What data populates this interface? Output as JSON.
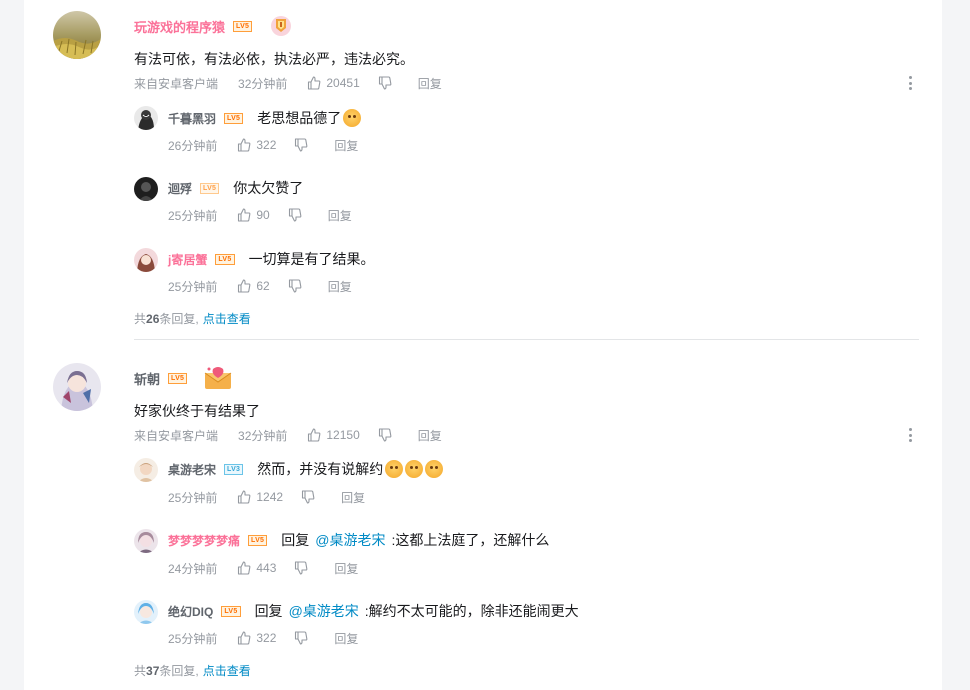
{
  "comments": [
    {
      "username": "玩游戏的程序猿",
      "level": "LV5",
      "content": "有法可依，有法必依，执法必严，违法必究。",
      "source": "来自安卓客户端",
      "time": "32分钟前",
      "likes": "20451",
      "reply_label": "回复",
      "replies": [
        {
          "username": "千暮黑羽",
          "level": "LV5",
          "text": "老思想品德了",
          "time": "26分钟前",
          "likes": "322"
        },
        {
          "username": "迴殍",
          "level": "LV5",
          "text": "你太欠赞了",
          "time": "25分钟前",
          "likes": "90"
        },
        {
          "username": "j寄居蟹",
          "level": "LV5",
          "text": "一切算是有了结果。",
          "time": "25分钟前",
          "likes": "62"
        }
      ],
      "summary": {
        "prefix": "共",
        "count": "26",
        "suffix": "条回复,",
        "link": "点击查看"
      }
    },
    {
      "username": "斩朝",
      "level": "LV5",
      "content": "好家伙终于有结果了",
      "source": "来自安卓客户端",
      "time": "32分钟前",
      "likes": "12150",
      "reply_label": "回复",
      "replies": [
        {
          "username": "桌游老宋",
          "level": "LV3",
          "text": "然而，并没有说解约",
          "time": "25分钟前",
          "likes": "1242"
        },
        {
          "username": "梦梦梦梦梦痛",
          "level": "LV5",
          "reply_word": "回复",
          "at": "@桌游老宋",
          "text": ":这都上法庭了，还解什么",
          "time": "24分钟前",
          "likes": "443"
        },
        {
          "username": "绝幻DIQ",
          "level": "LV5",
          "reply_word": "回复",
          "at": "@桌游老宋",
          "text": ":解约不太可能的，除非还能闹更大",
          "time": "25分钟前",
          "likes": "322"
        }
      ],
      "summary": {
        "prefix": "共",
        "count": "37",
        "suffix": "条回复,",
        "link": "点击查看"
      }
    }
  ],
  "colors": {
    "pink": "#fb7299",
    "link": "#008ac5",
    "meta": "#9499a0",
    "level_orange": "#ff6f00",
    "level_blue": "#38a7d6"
  }
}
